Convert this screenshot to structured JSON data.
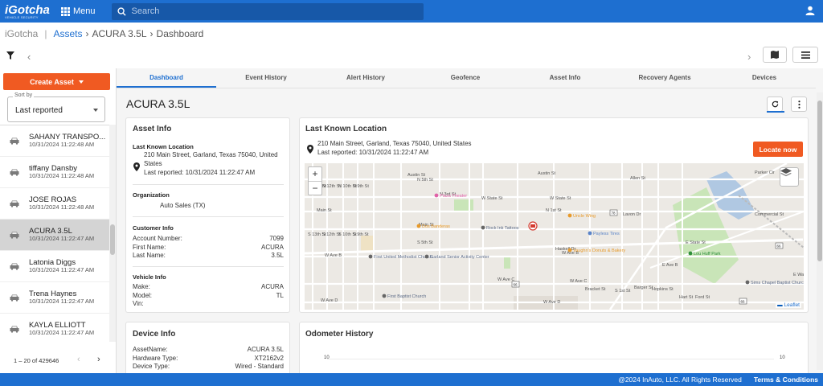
{
  "app": {
    "logo": "iGotcha",
    "logo_tag": "VEHICLE SECURITY"
  },
  "topbar": {
    "menu_label": "Menu",
    "search_placeholder": "Search"
  },
  "breadcrumb": {
    "app": "iGotcha",
    "assets": "Assets",
    "asset": "ACURA 3.5L",
    "page": "Dashboard"
  },
  "sidebar": {
    "create_label": "Create Asset",
    "sort_label": "Sort by",
    "sort_value": "Last reported",
    "items": [
      {
        "name": "SAHANY TRANSPO...",
        "date": "10/31/2024 11:22:48 AM"
      },
      {
        "name": "tiffany Dansby",
        "date": "10/31/2024 11:22:48 AM"
      },
      {
        "name": "JOSE ROJAS",
        "date": "10/31/2024 11:22:48 AM"
      },
      {
        "name": "ACURA 3.5L",
        "date": "10/31/2024 11:22:47 AM"
      },
      {
        "name": "Latonia Diggs",
        "date": "10/31/2024 11:22:47 AM"
      },
      {
        "name": "Trena Haynes",
        "date": "10/31/2024 11:22:47 AM"
      },
      {
        "name": "KAYLA ELLIOTT",
        "date": "10/31/2024 11:22:47 AM"
      }
    ],
    "pager": "1 – 20 of 429646"
  },
  "tabs": [
    "Dashboard",
    "Event History",
    "Alert History",
    "Geofence",
    "Asset Info",
    "Recovery Agents",
    "Devices"
  ],
  "asset_title": "ACURA 3.5L",
  "asset_info": {
    "title": "Asset Info",
    "last_known_label": "Last Known Location",
    "address": "210 Main Street, Garland, Texas 75040, United States",
    "last_reported": "Last reported: 10/31/2024 11:22:47 AM",
    "organization_label": "Organization",
    "organization": "Auto Sales (TX)",
    "customer_label": "Customer Info",
    "customer": [
      {
        "k": "Account Number:",
        "v": "7099"
      },
      {
        "k": "First Name:",
        "v": "ACURA"
      },
      {
        "k": "Last Name:",
        "v": "3.5L"
      }
    ],
    "vehicle_label": "Vehicle Info",
    "vehicle": [
      {
        "k": "Make:",
        "v": "ACURA"
      },
      {
        "k": "Model:",
        "v": "TL"
      },
      {
        "k": "Vin:",
        "v": ""
      }
    ]
  },
  "location": {
    "title": "Last Known Location",
    "address": "210 Main Street, Garland, Texas 75040, United States",
    "last_reported": "Last reported: 10/31/2024 11:22:47 AM",
    "locate_label": "Locate now",
    "attribution": "Leaflet"
  },
  "map": {
    "streets": [
      "Austin St",
      "Austin St",
      "W State St",
      "W State St",
      "Main St",
      "Main St",
      "W Ave B",
      "W Ave B",
      "W Ave C",
      "W Ave C",
      "W Ave D",
      "W Ave D",
      "E Ave B",
      "N 13th St",
      "N 12th St",
      "N 10th St",
      "N 9th St",
      "N 5th St",
      "N 3rd St",
      "S 13th St",
      "S 12th St",
      "S 10th St",
      "S 9th St",
      "S 5th St",
      "N 1st St",
      "Haskell Dr",
      "Bracket St",
      "S 1st St",
      "Barger St",
      "Hopkins St",
      "Hart St",
      "Ford St",
      "Allen St",
      "Lavon Dr",
      "E State St",
      "Commercial St",
      "Parker Cir",
      "E Walnut St",
      "Liste"
    ],
    "pois": [
      "Plaza Theater",
      "Dos Banderas",
      "Uncle Wing",
      "Payless Tires",
      "Rock Ink Tattoos",
      "First United Methodist Church",
      "Garland Senior Activity Center",
      "Vaughn's Donuts & Bakery",
      "Lou Huff Park",
      "Sims Chapel Baptist Church",
      "First Baptist Church"
    ],
    "road_shields": [
      "78",
      "66",
      "66",
      "66"
    ]
  },
  "device_info": {
    "title": "Device Info",
    "rows": [
      {
        "k": "AssetName:",
        "v": "ACURA 3.5L"
      },
      {
        "k": "Hardware Type:",
        "v": "XT2162v2"
      },
      {
        "k": "Device Type:",
        "v": "Wired - Standard"
      }
    ]
  },
  "odometer": {
    "title": "Odometer History",
    "y_left": "10",
    "y_right": "10"
  },
  "footer": {
    "copyright": "@2024 InAuto, LLC. All Rights Reserved",
    "terms": "Terms & Conditions"
  },
  "colors": {
    "brand": "#1e6fd0",
    "accent": "#f05a22"
  }
}
